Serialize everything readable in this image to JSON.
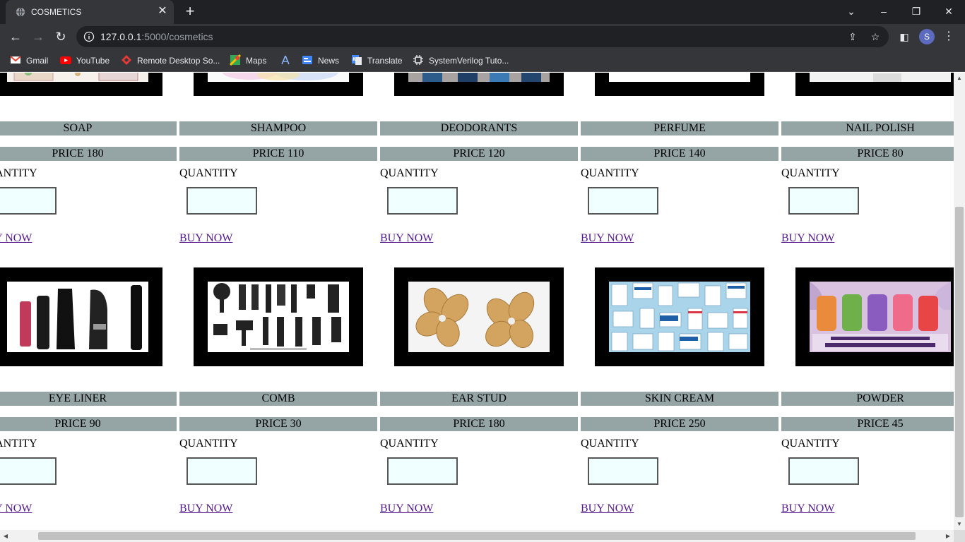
{
  "browser": {
    "tab_title": "COSMETICS",
    "tab_close_glyph": "✕",
    "new_tab_glyph": "+",
    "url_host": "127.0.0.1",
    "url_rest": ":5000/cosmetics",
    "profile_initial": "S",
    "bookmarks": [
      {
        "label": "Gmail",
        "icon": "gmail-icon",
        "color": "#ea4335"
      },
      {
        "label": "YouTube",
        "icon": "youtube-icon",
        "color": "#ff0000"
      },
      {
        "label": "Remote Desktop So...",
        "icon": "remote-desktop-icon",
        "color": "#e53935"
      },
      {
        "label": "Maps",
        "icon": "maps-icon",
        "color": "#34a853"
      },
      {
        "label": "",
        "icon": "app-icon",
        "color": "#8ab4f8"
      },
      {
        "label": "News",
        "icon": "news-icon",
        "color": "#4285f4"
      },
      {
        "label": "Translate",
        "icon": "translate-icon",
        "color": "#4285f4"
      },
      {
        "label": "SystemVerilog Tuto...",
        "icon": "chip-icon",
        "color": "#e8eaed"
      }
    ]
  },
  "page": {
    "quantity_label": "QUANTITY",
    "buy_label": "BUY NOW",
    "rows": [
      [
        {
          "name": "SOAP",
          "price": "PRICE 180",
          "image": "soap-image"
        },
        {
          "name": "SHAMPOO",
          "price": "PRICE 110",
          "image": "shampoo-image"
        },
        {
          "name": "DEODORANTS",
          "price": "PRICE 120",
          "image": "deodorants-image"
        },
        {
          "name": "PERFUME",
          "price": "PRICE 140",
          "image": "perfume-image"
        },
        {
          "name": "NAIL POLISH",
          "price": "PRICE 80",
          "image": "nail-polish-image"
        }
      ],
      [
        {
          "name": "EYE LINER",
          "price": "PRICE 90",
          "image": "eye-liner-image"
        },
        {
          "name": "COMB",
          "price": "PRICE 30",
          "image": "comb-image"
        },
        {
          "name": "EAR STUD",
          "price": "PRICE 180",
          "image": "ear-stud-image"
        },
        {
          "name": "SKIN CREAM",
          "price": "PRICE 250",
          "image": "skin-cream-image"
        },
        {
          "name": "POWDER",
          "price": "PRICE 45",
          "image": "powder-image"
        }
      ]
    ]
  },
  "colors": {
    "label_bar": "#95a5a6",
    "input_bg": "#f0ffff",
    "link": "#551a8b"
  }
}
